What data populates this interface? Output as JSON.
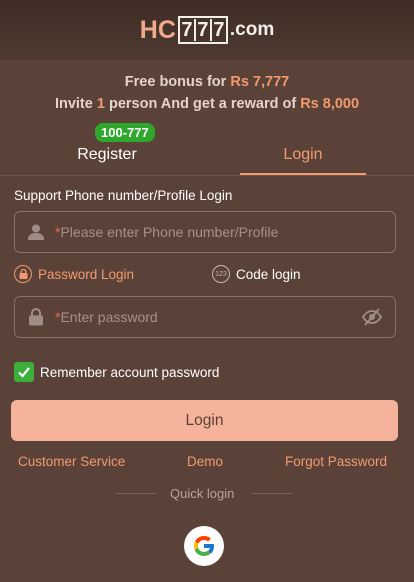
{
  "header": {
    "logo_hc": "HC",
    "logo_digits": [
      "7",
      "7",
      "7"
    ],
    "logo_suffix": ".com"
  },
  "bonus": {
    "line1_prefix": "Free bonus for",
    "line1_amount": "Rs 7,777",
    "line2_prefix": "Invite",
    "line2_count": "1",
    "line2_middle": "person And get a reward of",
    "line2_amount": "Rs 8,000"
  },
  "tabs": {
    "register_label": "Register",
    "login_label": "Login",
    "promo_badge": "100-777",
    "active": "Login"
  },
  "form": {
    "phone_label": "Support Phone number/Profile Login",
    "phone_required_mark": "*",
    "phone_placeholder": "Please enter Phone number/Profile",
    "password_mode_label": "Password Login",
    "code_mode_label": "Code login",
    "code_icon_text": "123",
    "password_required_mark": "*",
    "password_placeholder": "Enter password",
    "remember_label": "Remember account password",
    "remember_checked": true,
    "login_button": "Login"
  },
  "links": {
    "customer_service": "Customer Service",
    "demo": "Demo",
    "forgot_password": "Forgot Password"
  },
  "quick_login": {
    "label": "Quick login",
    "providers": [
      "google-icon"
    ]
  },
  "colors": {
    "background": "#5b4238",
    "accent": "#f19a6f",
    "button": "#f5b39b",
    "badge": "#2fa62c",
    "checkbox": "#3cae3c"
  }
}
